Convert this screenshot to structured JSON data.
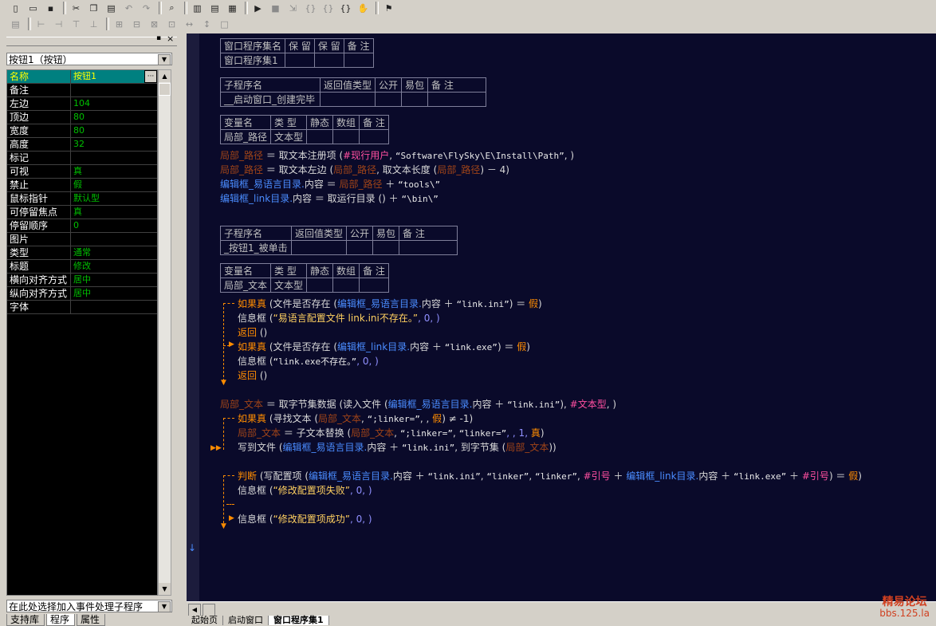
{
  "toolbar1": {
    "icons": [
      "new-file-icon",
      "open-folder-icon",
      "save-icon",
      "cut-icon",
      "copy-icon",
      "paste-icon",
      "undo-icon",
      "redo-icon",
      "find-icon",
      "layout-1-icon",
      "layout-2-icon",
      "layout-3-icon",
      "run-icon",
      "stop-icon",
      "step-icon",
      "step-into-icon",
      "step-over-icon",
      "step-out-icon",
      "breakpoint-icon",
      "debug-icon"
    ]
  },
  "toolbar2": {
    "icons": [
      "align-1-icon",
      "align-2-icon",
      "align-3-icon",
      "align-4-icon",
      "align-5-icon",
      "align-6-icon",
      "align-7-icon",
      "align-8-icon",
      "align-9-icon",
      "align-10-icon",
      "align-11-icon",
      "align-12-icon"
    ]
  },
  "left": {
    "object_combo": "按钮1（按钮）",
    "properties": [
      {
        "name": "名称",
        "value": "按钮1"
      },
      {
        "name": "备注",
        "value": ""
      },
      {
        "name": "左边",
        "value": "104"
      },
      {
        "name": "顶边",
        "value": "80"
      },
      {
        "name": "宽度",
        "value": "80"
      },
      {
        "name": "高度",
        "value": "32"
      },
      {
        "name": "标记",
        "value": ""
      },
      {
        "name": "可视",
        "value": "真"
      },
      {
        "name": "禁止",
        "value": "假"
      },
      {
        "name": "鼠标指针",
        "value": "默认型"
      },
      {
        "name": "可停留焦点",
        "value": "真"
      },
      {
        "name": "  停留顺序",
        "value": "0"
      },
      {
        "name": "图片",
        "value": ""
      },
      {
        "name": "类型",
        "value": "通常"
      },
      {
        "name": "标题",
        "value": "修改"
      },
      {
        "name": "横向对齐方式",
        "value": "居中"
      },
      {
        "name": "纵向对齐方式",
        "value": "居中"
      },
      {
        "name": "字体",
        "value": ""
      }
    ],
    "event_combo": "在此处选择加入事件处理子程序",
    "tabs": [
      "支持库",
      "程序",
      "属性"
    ]
  },
  "editor": {
    "t1": {
      "headers": [
        "窗口程序集名",
        "保 留",
        "保 留",
        "备 注"
      ],
      "row": [
        "窗口程序集1",
        "",
        "",
        ""
      ]
    },
    "t2": {
      "headers": [
        "子程序名",
        "返回值类型",
        "公开",
        "易包",
        "备 注"
      ],
      "row": [
        "__启动窗口_创建完毕",
        "",
        "",
        "",
        ""
      ]
    },
    "t3": {
      "headers": [
        "变量名",
        "类 型",
        "静态",
        "数组",
        "备 注"
      ],
      "row": [
        "局部_路径",
        "文本型",
        "",
        "",
        ""
      ]
    },
    "t4": {
      "headers": [
        "子程序名",
        "返回值类型",
        "公开",
        "易包",
        "备 注"
      ],
      "row": [
        "_按钮1_被单击",
        "",
        "",
        "",
        ""
      ]
    },
    "t5": {
      "headers": [
        "变量名",
        "类 型",
        "静态",
        "数组",
        "备 注"
      ],
      "row": [
        "局部_文本",
        "文本型",
        "",
        "",
        ""
      ]
    },
    "lines": {
      "l1a": "局部_路径",
      "l1b": " ＝ 取文本注册项 (",
      "l1c": "#现行用户",
      "l1d": ", ",
      "l1e": "“Software\\FlySky\\E\\Install\\Path”",
      "l1f": ", )",
      "l2a": "局部_路径",
      "l2b": " ＝ 取文本左边 (",
      "l2c": "局部_路径",
      "l2d": ", 取文本长度 (",
      "l2e": "局部_路径",
      "l2f": ") － 4)",
      "l3a": "编辑框_易语言目录.",
      "l3b": "内容 ＝ ",
      "l3c": "局部_路径",
      "l3d": " ＋ ",
      "l3e": "“tools\\”",
      "l4a": "编辑框_link目录.",
      "l4b": "内容 ＝ 取运行目录 () ＋ ",
      "l4c": "“\\bin\\”",
      "l5a": "如果真",
      "l5b": " (文件是否存在 (",
      "l5c": "编辑框_易语言目录.",
      "l5d": "内容 ＋ ",
      "l5e": "“link.ini”",
      "l5f": ") ＝ ",
      "l5g": "假",
      "l5h": ")",
      "l6a": "信息框",
      "l6b": " (",
      "l6c": "“易语言配置文件 link.ini不存在。”",
      "l6d": ", 0, )",
      "l7a": "返回",
      "l7b": " ()",
      "l8a": "如果真",
      "l8b": " (文件是否存在 (",
      "l8c": "编辑框_link目录.",
      "l8d": "内容 ＋ ",
      "l8e": "“link.exe”",
      "l8f": ") ＝ ",
      "l8g": "假",
      "l8h": ")",
      "l9a": "信息框",
      "l9b": " (",
      "l9c": "“link.exe不存在。”",
      "l9d": ", 0, )",
      "l10a": "返回",
      "l10b": " ()",
      "l11a": "局部_文本",
      "l11b": " ＝ 取字节集数据 (读入文件 (",
      "l11c": "编辑框_易语言目录.",
      "l11d": "内容 ＋ ",
      "l11e": "“link.ini”",
      "l11f": "), ",
      "l11g": "#文本型",
      "l11h": ", )",
      "l12a": "如果真",
      "l12b": " (寻找文本 (",
      "l12c": "局部_文本",
      "l12d": ", ",
      "l12e": "“;linker=”",
      "l12f": ", , ",
      "l12g": "假",
      "l12h": ") ≠ -1)",
      "l13a": "局部_文本",
      "l13b": " ＝ 子文本替换 (",
      "l13c": "局部_文本",
      "l13d": ", ",
      "l13e": "“;linker=”",
      "l13f": ", ",
      "l13g": "“linker=”",
      "l13h": ", , 1, ",
      "l13i": "真",
      "l13j": ")",
      "l14a": "写到文件",
      "l14b": " (",
      "l14c": "编辑框_易语言目录.",
      "l14d": "内容 ＋ ",
      "l14e": "“link.ini”",
      "l14f": ", 到字节集 (",
      "l14g": "局部_文本",
      "l14h": "))",
      "l15a": "判断",
      "l15b": " (写配置项 (",
      "l15c": "编辑框_易语言目录.",
      "l15d": "内容 ＋ ",
      "l15e": "“link.ini”",
      "l15f": ", ",
      "l15g": "“linker”",
      "l15h": ", ",
      "l15i": "“linker”",
      "l15j": ", ",
      "l15k": "#引号",
      "l15l": " ＋ ",
      "l15m": "编辑框_link目录.",
      "l15n": "内容 ＋ ",
      "l15o": "“link.exe”",
      "l15p": " ＋ ",
      "l15q": "#引号",
      "l15r": ") ＝ ",
      "l15s": "假",
      "l15t": ")",
      "l16a": "信息框",
      "l16b": " (",
      "l16c": "“修改配置项失败”",
      "l16d": ", 0, )",
      "l17a": "信息框",
      "l17b": " (",
      "l17c": "“修改配置项成功”",
      "l17d": ", 0, )"
    }
  },
  "bottom_tabs": [
    "起始页",
    "启动窗口",
    "窗口程序集1"
  ],
  "watermark": {
    "line1": "精易论坛",
    "line2": "bbs.125.la"
  },
  "colors": {
    "editor_bg": "#0a0a2a",
    "property_value": "#00c000",
    "control_keyword": "#ff8c00",
    "variable": "#a04418",
    "constant": "#ff4fa0"
  }
}
